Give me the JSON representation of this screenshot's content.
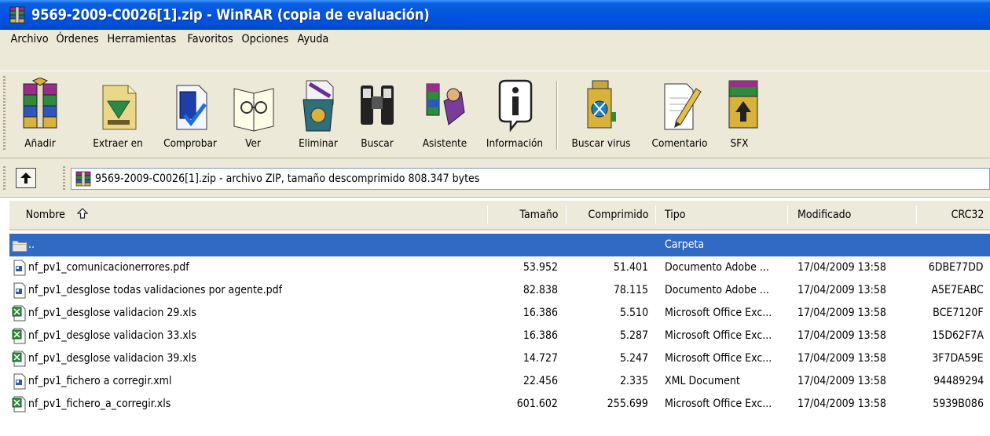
{
  "window": {
    "title": "9569-2009-C0026[1].zip - WinRAR (copia de evaluación)"
  },
  "menu": {
    "items": [
      "Archivo",
      "Órdenes",
      "Herramientas",
      "Favoritos",
      "Opciones",
      "Ayuda"
    ]
  },
  "toolbar": {
    "buttons": [
      {
        "label": "Añadir",
        "icon": "add-archive-icon"
      },
      {
        "label": "Extraer en",
        "icon": "extract-icon"
      },
      {
        "label": "Comprobar",
        "icon": "test-icon"
      },
      {
        "label": "Ver",
        "icon": "view-icon"
      },
      {
        "label": "Eliminar",
        "icon": "delete-icon"
      },
      {
        "label": "Buscar",
        "icon": "find-icon"
      },
      {
        "label": "Asistente",
        "icon": "wizard-icon"
      },
      {
        "label": "Información",
        "icon": "info-icon"
      },
      {
        "label": "Buscar virus",
        "icon": "virus-scan-icon"
      },
      {
        "label": "Comentario",
        "icon": "comment-icon"
      },
      {
        "label": "SFX",
        "icon": "sfx-icon"
      }
    ]
  },
  "address": {
    "text": "9569-2009-C0026[1].zip - archivo ZIP, tamaño descomprimido 808.347 bytes"
  },
  "columns": {
    "name": "Nombre",
    "size": "Tamaño",
    "packed": "Comprimido",
    "type": "Tipo",
    "modified": "Modificado",
    "crc": "CRC32"
  },
  "rows": [
    {
      "name": "..",
      "size": "",
      "packed": "",
      "type": "Carpeta",
      "modified": "",
      "crc": "",
      "icon": "folder-icon",
      "selected": true
    },
    {
      "name": "nf_pv1_comunicacionerrores.pdf",
      "size": "53.952",
      "packed": "51.401",
      "type": "Documento Adobe ...",
      "modified": "17/04/2009 13:58",
      "crc": "6DBE77DD",
      "icon": "document-icon"
    },
    {
      "name": "nf_pv1_desglose todas validaciones por agente.pdf",
      "size": "82.838",
      "packed": "78.115",
      "type": "Documento Adobe ...",
      "modified": "17/04/2009 13:58",
      "crc": "A5E7EABC",
      "icon": "document-icon"
    },
    {
      "name": "nf_pv1_desglose validacion 29.xls",
      "size": "16.386",
      "packed": "5.510",
      "type": "Microsoft Office Exc...",
      "modified": "17/04/2009 13:58",
      "crc": "BCE7120F",
      "icon": "excel-icon"
    },
    {
      "name": "nf_pv1_desglose validacion 33.xls",
      "size": "16.386",
      "packed": "5.287",
      "type": "Microsoft Office Exc...",
      "modified": "17/04/2009 13:58",
      "crc": "15D62F7A",
      "icon": "excel-icon"
    },
    {
      "name": "nf_pv1_desglose validacion 39.xls",
      "size": "14.727",
      "packed": "5.247",
      "type": "Microsoft Office Exc...",
      "modified": "17/04/2009 13:58",
      "crc": "3F7DA59E",
      "icon": "excel-icon"
    },
    {
      "name": "nf_pv1_fichero a corregir.xml",
      "size": "22.456",
      "packed": "2.335",
      "type": "XML Document",
      "modified": "17/04/2009 13:58",
      "crc": "94489294",
      "icon": "document-icon"
    },
    {
      "name": "nf_pv1_fichero_a_corregir.xls",
      "size": "601.602",
      "packed": "255.699",
      "type": "Microsoft Office Exc...",
      "modified": "17/04/2009 13:58",
      "crc": "5939B086",
      "icon": "excel-icon"
    }
  ],
  "colors": {
    "titlebar": "#0054e3",
    "chrome": "#ece9d8",
    "selection": "#316ac5"
  }
}
